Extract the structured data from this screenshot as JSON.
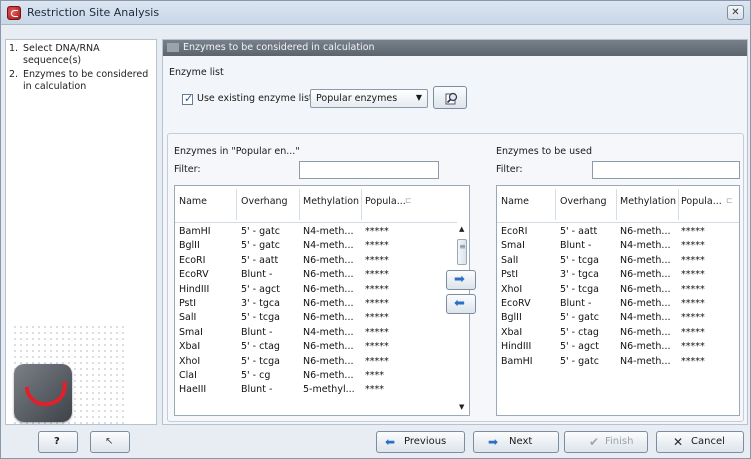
{
  "window": {
    "title": "Restriction Site Analysis",
    "close_label": "✕"
  },
  "steps": [
    {
      "num": "1.",
      "label": "Select DNA/RNA sequence(s)"
    },
    {
      "num": "2.",
      "label": "Enzymes to be considered in calculation"
    }
  ],
  "panel": {
    "header": "Enzymes to be considered in calculation",
    "enzyme_list_label": "Enzyme list",
    "use_existing_label": "Use existing enzyme list",
    "use_existing_checked": true,
    "list_select_value": "Popular enzymes"
  },
  "left_list": {
    "title": "Enzymes in \"Popular en...\"",
    "filter_label": "Filter:",
    "filter_value": "",
    "columns": [
      "Name",
      "Overhang",
      "Methylation",
      "Popula..."
    ],
    "rows": [
      [
        "BamHI",
        "5' - gatc",
        "N4-meth...",
        "*****"
      ],
      [
        "BglII",
        "5' - gatc",
        "N4-meth...",
        "*****"
      ],
      [
        "EcoRI",
        "5' - aatt",
        "N6-meth...",
        "*****"
      ],
      [
        "EcoRV",
        "Blunt -",
        "N6-meth...",
        "*****"
      ],
      [
        "HindIII",
        "5' - agct",
        "N6-meth...",
        "*****"
      ],
      [
        "PstI",
        "3' - tgca",
        "N6-meth...",
        "*****"
      ],
      [
        "SalI",
        "5' - tcga",
        "N6-meth...",
        "*****"
      ],
      [
        "SmaI",
        "Blunt -",
        "N4-meth...",
        "*****"
      ],
      [
        "XbaI",
        "5' - ctag",
        "N6-meth...",
        "*****"
      ],
      [
        "XhoI",
        "5' - tcga",
        "N6-meth...",
        "*****"
      ],
      [
        "ClaI",
        "5' - cg",
        "N6-meth...",
        "****"
      ],
      [
        "HaeIII",
        "Blunt -",
        "5-methyl...",
        "****"
      ]
    ]
  },
  "right_list": {
    "title": "Enzymes to be used",
    "filter_label": "Filter:",
    "filter_value": "",
    "columns": [
      "Name",
      "Overhang",
      "Methylation",
      "Popula..."
    ],
    "rows": [
      [
        "EcoRI",
        "5' - aatt",
        "N6-meth...",
        "*****"
      ],
      [
        "SmaI",
        "Blunt -",
        "N4-meth...",
        "*****"
      ],
      [
        "SalI",
        "5' - tcga",
        "N6-meth...",
        "*****"
      ],
      [
        "PstI",
        "3' - tgca",
        "N6-meth...",
        "*****"
      ],
      [
        "XhoI",
        "5' - tcga",
        "N6-meth...",
        "*****"
      ],
      [
        "EcoRV",
        "Blunt -",
        "N6-meth...",
        "*****"
      ],
      [
        "BglII",
        "5' - gatc",
        "N4-meth...",
        "*****"
      ],
      [
        "XbaI",
        "5' - ctag",
        "N6-meth...",
        "*****"
      ],
      [
        "HindIII",
        "5' - agct",
        "N6-meth...",
        "*****"
      ],
      [
        "BamHI",
        "5' - gatc",
        "N4-meth...",
        "*****"
      ]
    ]
  },
  "icons": {
    "move_right": "arrow-right-icon",
    "move_left": "arrow-left-icon",
    "browse": "magnifier-icon"
  },
  "footer": {
    "help_label": "?",
    "reset_label": "↖",
    "previous_label": "Previous",
    "next_label": "Next",
    "finish_label": "Finish",
    "cancel_label": "Cancel"
  },
  "colors": {
    "accent_arrow": "#2a6fc4",
    "cancel_x": "#2a2a2a",
    "logo_red": "#e0202a"
  }
}
